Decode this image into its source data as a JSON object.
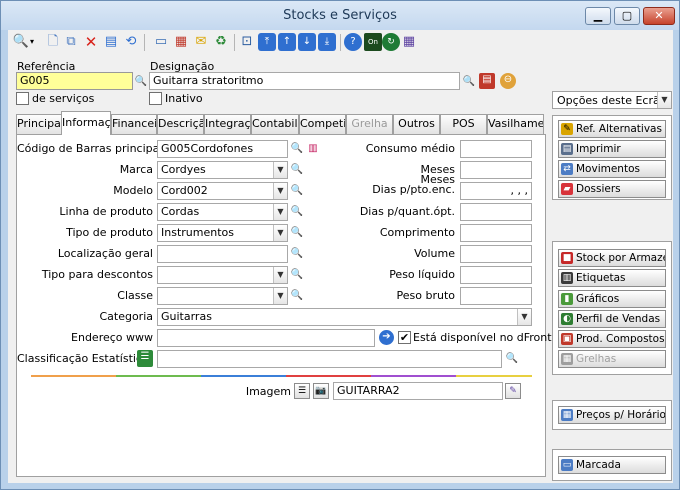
{
  "window": {
    "title": "Stocks e Serviços"
  },
  "toolbar": {
    "icons": [
      "search-icon",
      "new-document-icon",
      "copy-icon",
      "delete-icon",
      "properties-icon",
      "refresh-icon",
      "view-icon",
      "print-icon",
      "mail-icon",
      "recycle-icon",
      "preview-icon",
      "first-icon",
      "previous-icon",
      "next-icon",
      "last-icon",
      "help-icon",
      "on-icon",
      "sync-icon",
      "calendar-icon"
    ]
  },
  "header": {
    "referencia_label": "Referência",
    "referencia_value": "G005",
    "designacao_label": "Designação",
    "designacao_value": "Guitarra stratoritmo",
    "de_servicos_label": "de serviços",
    "inativo_label": "Inativo"
  },
  "tabs": [
    {
      "label": "Principal",
      "active": false,
      "disabled": false
    },
    {
      "label": "Informaçã",
      "active": true,
      "disabled": false
    },
    {
      "label": "Financeiro",
      "active": false,
      "disabled": false
    },
    {
      "label": "Descrição",
      "active": false,
      "disabled": false
    },
    {
      "label": "Integraçã",
      "active": false,
      "disabled": false
    },
    {
      "label": "Contabilid",
      "active": false,
      "disabled": false
    },
    {
      "label": "Competid",
      "active": false,
      "disabled": false
    },
    {
      "label": "Grelha",
      "active": false,
      "disabled": true
    },
    {
      "label": "Outros",
      "active": false,
      "disabled": false
    },
    {
      "label": "POS",
      "active": false,
      "disabled": false
    },
    {
      "label": "Vasilhames",
      "active": false,
      "disabled": false
    }
  ],
  "form": {
    "codigo_barras_label": "Código de Barras principal",
    "codigo_barras_value": "G005Cordofones",
    "marca_label": "Marca",
    "marca_value": "Cordyes",
    "modelo_label": "Modelo",
    "modelo_value": "Cord002",
    "linha_produto_label": "Linha de produto",
    "linha_produto_value": "Cordas",
    "tipo_produto_label": "Tipo de produto",
    "tipo_produto_value": "Instrumentos",
    "localizacao_label": "Localização geral",
    "localizacao_value": "",
    "tipo_descontos_label": "Tipo para descontos",
    "tipo_descontos_value": "",
    "classe_label": "Classe",
    "classe_value": "",
    "categoria_label": "Categoria",
    "categoria_value": "Guitarras",
    "endereco_label": "Endereço www",
    "endereco_value": "",
    "disponivel_label": "Está disponível no dFront",
    "classificacao_label": "Classificação Estatística",
    "classificacao_value": "",
    "imagem_label": "Imagem",
    "imagem_value": "GUITARRA2",
    "consumo_label": "Consumo médio",
    "meses_label": "Meses",
    "meses_dias_label_1": "Meses",
    "meses_dias_label_2": "Dias p/pto.enc.",
    "meses_dias_value": ",  ,  ,",
    "dias_quant_label": "Dias p/quant.ópt.",
    "comprimento_label": "Comprimento",
    "volume_label": "Volume",
    "peso_liquido_label": "Peso líquido",
    "peso_bruto_label": "Peso bruto"
  },
  "sidebar": {
    "options_label": "Opções deste Ecrã",
    "group1": [
      {
        "label": "Ref. Alternativas",
        "icon": "pencil-icon",
        "color": "#d9a400",
        "disabled": false
      },
      {
        "label": "Imprimir",
        "icon": "print-icon",
        "color": "#5a6e8c",
        "disabled": false
      },
      {
        "label": "Movimentos",
        "icon": "movements-icon",
        "color": "#4c7cc4",
        "disabled": false
      },
      {
        "label": "Dossiers",
        "icon": "dossiers-icon",
        "color": "#d8333a",
        "disabled": false
      }
    ],
    "group2": [
      {
        "label": "Stock por Armazém",
        "icon": "warehouse-icon",
        "color": "#c62828",
        "disabled": false
      },
      {
        "label": "Etiquetas",
        "icon": "labels-icon",
        "color": "#3a3a3a",
        "disabled": false
      },
      {
        "label": "Gráficos",
        "icon": "chart-icon",
        "color": "#4a9a3a",
        "disabled": false
      },
      {
        "label": "Perfil de Vendas",
        "icon": "sales-profile-icon",
        "color": "#2e7d32",
        "disabled": false
      },
      {
        "label": "Prod. Compostos",
        "icon": "composite-icon",
        "color": "#c0392b",
        "disabled": false
      },
      {
        "label": "Grelhas",
        "icon": "grid-icon",
        "color": "#9e9e9e",
        "disabled": true
      }
    ],
    "precos_label": "Preços p/ Horário",
    "marcada_label": "Marcada"
  },
  "colors": {
    "yellow_field": "#ffff99",
    "stripes": [
      "#f0a04b",
      "#6dbb4f",
      "#3b7fd8",
      "#e04040",
      "#a04fd0",
      "#e8d040"
    ]
  }
}
